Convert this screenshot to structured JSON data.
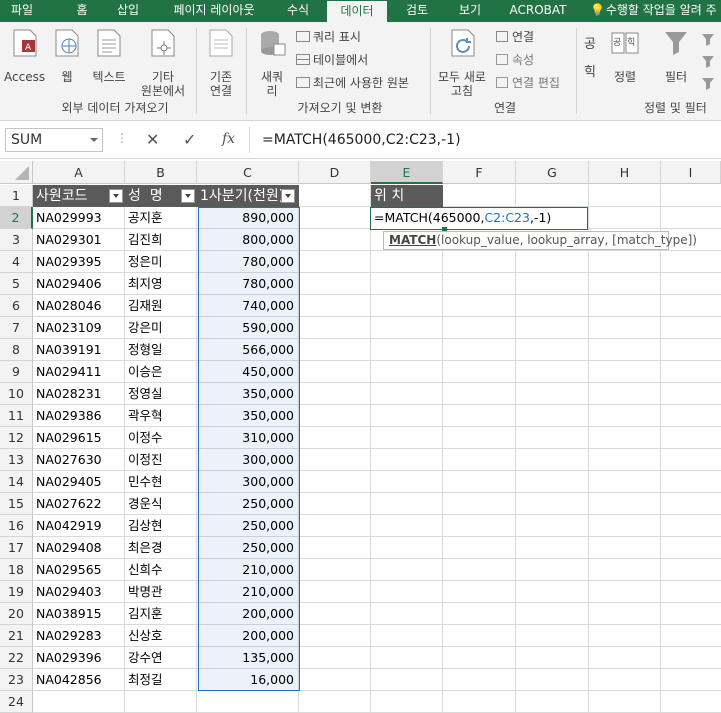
{
  "tabs": [
    "파일",
    "홈",
    "삽입",
    "페이지 레이아웃",
    "수식",
    "데이터",
    "검토",
    "보기",
    "ACROBAT",
    "수행할 작업을 알려 주"
  ],
  "ribbon": {
    "access": "Access",
    "web": "웹",
    "text": "텍스트",
    "other_line1": "기타",
    "other_line2": "원본에서",
    "existing_line1": "기존",
    "existing_line2": "연결",
    "newquery_line1": "새쿼",
    "newquery_line2": "리",
    "show_query": "쿼리 표시",
    "from_table": "테이블에서",
    "recent_sources": "최근에 사용한 원본",
    "refresh_line1": "모두 새로",
    "refresh_line2": "고침",
    "connections": "연결",
    "properties": "속성",
    "edit_links": "연결 편집",
    "sort_az": "공",
    "sort_za": "힉",
    "sort": "정렬",
    "filter": "필터",
    "group_external": "외부 데이터 가져오기",
    "group_transform": "가져오기 및 변환",
    "group_connections": "연결",
    "group_sort": "정렬 및 필터"
  },
  "formula_bar": {
    "name_box": "SUM",
    "cancel": "✕",
    "enter": "✓",
    "fx": "fx",
    "formula": "=MATCH(465000,C2:C23,-1)"
  },
  "columns": [
    "A",
    "B",
    "C",
    "D",
    "E",
    "F",
    "G",
    "H",
    "I"
  ],
  "headers": {
    "a": "사원코드",
    "b": "성  명",
    "c": "1사분기(천원)",
    "e": "위 치"
  },
  "rows": [
    {
      "code": "NA029993",
      "name": "공지훈",
      "value": "890,000"
    },
    {
      "code": "NA029301",
      "name": "김진희",
      "value": "800,000"
    },
    {
      "code": "NA029395",
      "name": "정은미",
      "value": "780,000"
    },
    {
      "code": "NA029406",
      "name": "최지영",
      "value": "780,000"
    },
    {
      "code": "NA028046",
      "name": "김재원",
      "value": "740,000"
    },
    {
      "code": "NA023109",
      "name": "강은미",
      "value": "590,000"
    },
    {
      "code": "NA039191",
      "name": "정형일",
      "value": "566,000"
    },
    {
      "code": "NA029411",
      "name": "이승은",
      "value": "450,000"
    },
    {
      "code": "NA028231",
      "name": "정영실",
      "value": "350,000"
    },
    {
      "code": "NA029386",
      "name": "곽우혁",
      "value": "350,000"
    },
    {
      "code": "NA029615",
      "name": "이정수",
      "value": "310,000"
    },
    {
      "code": "NA027630",
      "name": "이정진",
      "value": "300,000"
    },
    {
      "code": "NA029405",
      "name": "민수현",
      "value": "300,000"
    },
    {
      "code": "NA027622",
      "name": "경운식",
      "value": "250,000"
    },
    {
      "code": "NA042919",
      "name": "김상현",
      "value": "250,000"
    },
    {
      "code": "NA029408",
      "name": "최은경",
      "value": "250,000"
    },
    {
      "code": "NA029565",
      "name": "신희수",
      "value": "210,000"
    },
    {
      "code": "NA029403",
      "name": "박명관",
      "value": "210,000"
    },
    {
      "code": "NA038915",
      "name": "김지훈",
      "value": "200,000"
    },
    {
      "code": "NA029283",
      "name": "신상호",
      "value": "200,000"
    },
    {
      "code": "NA029396",
      "name": "강수연",
      "value": "135,000"
    },
    {
      "code": "NA042856",
      "name": "최정길",
      "value": "16,000"
    }
  ],
  "edit_cell": {
    "prefix": "=MATCH(465000,",
    "range": "C2:C23",
    "suffix": ",-1)"
  },
  "tooltip": {
    "func": "MATCH",
    "args": "(lookup_value, lookup_array, [match_type])"
  },
  "colors": {
    "excel_green": "#217346",
    "range_blue": "#1f6fc9",
    "header_fill": "#5a5a5a"
  }
}
